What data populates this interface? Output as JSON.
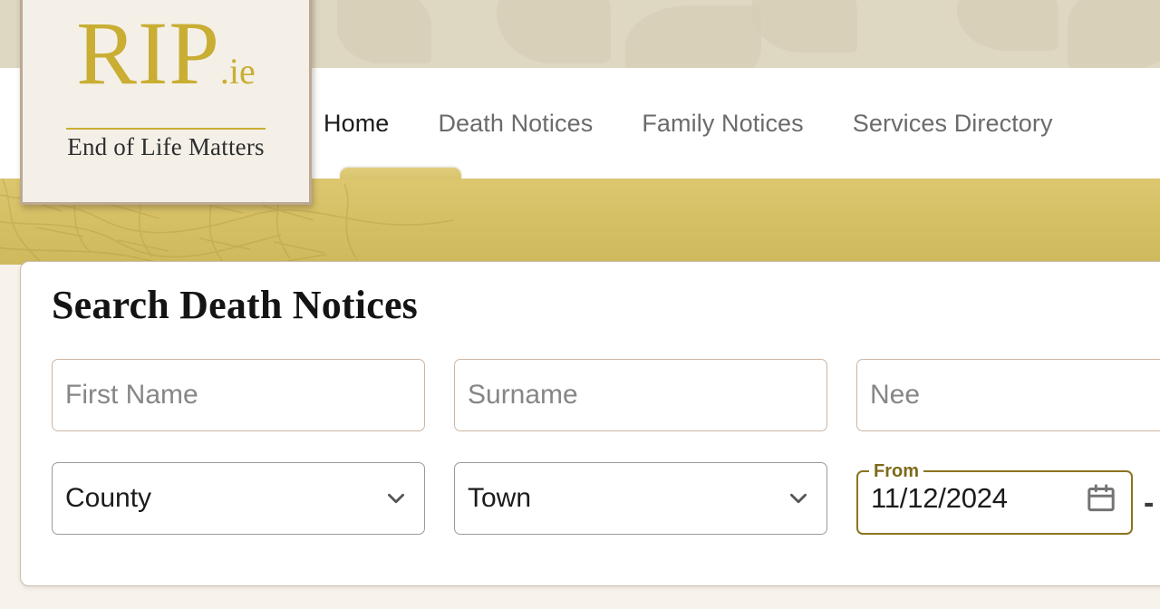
{
  "site": {
    "logo": {
      "mark": "RIP",
      "tld": ".ie",
      "tagline": "End of Life Matters"
    }
  },
  "nav": {
    "items": [
      {
        "label": "Home",
        "active": true
      },
      {
        "label": "Death Notices",
        "active": false
      },
      {
        "label": "Family Notices",
        "active": false
      },
      {
        "label": "Services Directory",
        "active": false
      }
    ]
  },
  "search_panel": {
    "title": "Search Death Notices",
    "fields": {
      "first_name": {
        "placeholder": "First Name",
        "value": ""
      },
      "surname": {
        "placeholder": "Surname",
        "value": ""
      },
      "nee": {
        "placeholder": "Nee",
        "value": ""
      },
      "county": {
        "value": "County"
      },
      "town": {
        "value": "Town"
      },
      "date_from": {
        "label": "From",
        "value": "11/12/2024"
      }
    },
    "range_separator": "-"
  },
  "icons": {
    "chevron_down": "chevron-down-icon",
    "calendar": "calendar-icon"
  },
  "colors": {
    "gold": "#d6c06a",
    "logo_gold": "#c9ae33",
    "beige_band": "#ded7c2",
    "page_bg": "#f7f3ec",
    "label_olive": "#7d6a1a",
    "input_border": "#cbb5a4",
    "select_border": "#9a9a9a"
  }
}
